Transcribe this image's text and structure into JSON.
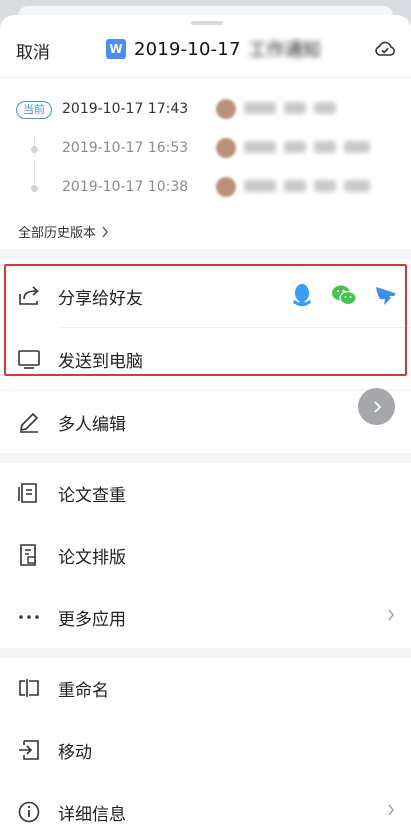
{
  "header": {
    "cancel_label": "取消",
    "doc_badge": "W",
    "title_date": "2019-10-17",
    "title_suffix": "工作通知",
    "sync_icon": "cloud-check-icon"
  },
  "versions": {
    "current_badge": "当前",
    "items": [
      {
        "date": "2019-10-17 17:43",
        "current": true
      },
      {
        "date": "2019-10-17 16:53",
        "current": false
      },
      {
        "date": "2019-10-17 10:38",
        "current": false
      }
    ],
    "history_link": "全部历史版本"
  },
  "actions": {
    "share": {
      "label": "分享给好友",
      "icon": "share-icon",
      "apps": [
        "qq-icon",
        "wechat-icon",
        "dingtalk-icon"
      ]
    },
    "send_pc": {
      "label": "发送到电脑",
      "icon": "computer-icon"
    },
    "collab": {
      "label": "多人编辑",
      "icon": "pencil-icon"
    },
    "thesis_check": {
      "label": "论文查重",
      "icon": "document-check-icon"
    },
    "thesis_format": {
      "label": "论文排版",
      "icon": "document-format-icon"
    },
    "more_apps": {
      "label": "更多应用",
      "icon": "more-dots-icon"
    },
    "rename": {
      "label": "重命名",
      "icon": "rename-icon"
    },
    "move": {
      "label": "移动",
      "icon": "move-icon"
    },
    "details": {
      "label": "详细信息",
      "icon": "info-icon"
    }
  },
  "colors": {
    "accent": "#4a8df6",
    "highlight": "#d43a3a",
    "qq": "#3a9cf5",
    "wechat": "#44c34d",
    "dingtalk": "#3a8ff0"
  }
}
